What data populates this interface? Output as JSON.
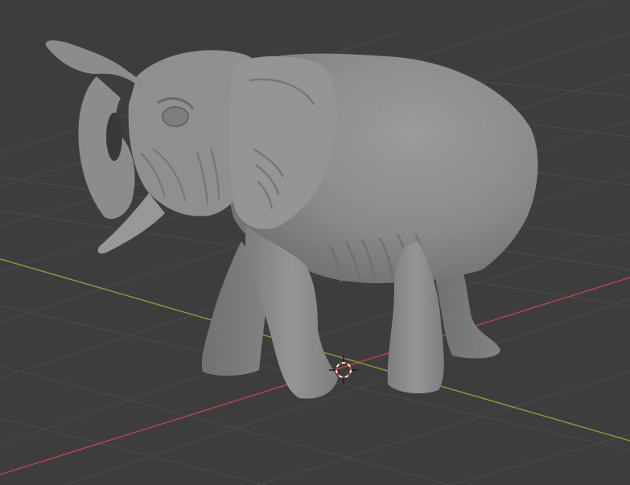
{
  "viewport": {
    "background": "#3d3d3d",
    "grid_color": "#4a4a4a",
    "x_axis_color": "#b4454d",
    "y_axis_color": "#7f9b3c"
  },
  "scene": {
    "object": "elephant-sculpture-mesh",
    "object_color": "#9a9a9a",
    "cursor_icon": "3d-cursor-icon"
  }
}
